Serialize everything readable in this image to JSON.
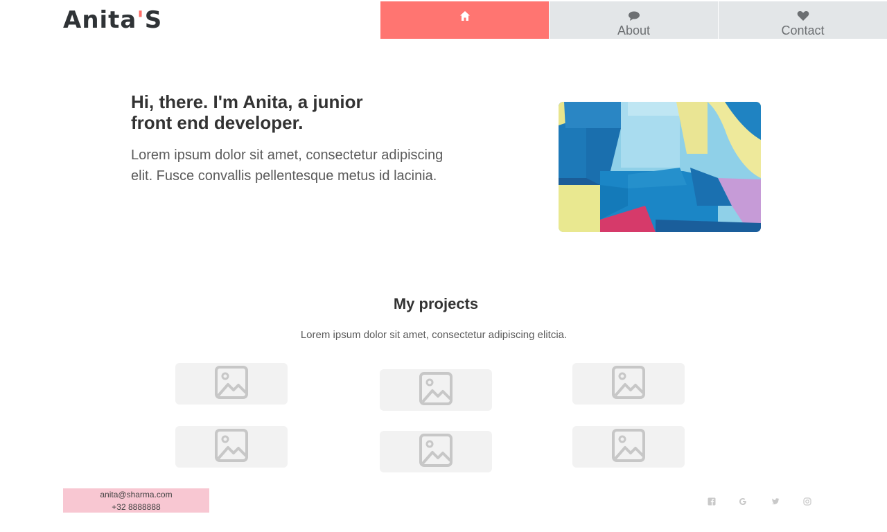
{
  "logo": {
    "name": "Anita",
    "apostrophe": "'",
    "suffix": "S"
  },
  "nav": {
    "items": [
      {
        "label": "",
        "icon": "home-icon",
        "active": true
      },
      {
        "label": "About",
        "icon": "comment-icon",
        "active": false
      },
      {
        "label": "Contact",
        "icon": "heart-icon",
        "active": false
      }
    ]
  },
  "hero": {
    "title": "Hi, there. I'm Anita, a junior front end developer.",
    "text": "Lorem ipsum dolor sit amet, consectetur adipiscing elit. Fusce convallis pellentesque metus id lacinia.",
    "image": "abstract-painting"
  },
  "projects": {
    "title": "My projects",
    "subtitle": "Lorem ipsum dolor sit amet, consectetur adipiscing elitcia.",
    "items": [
      {
        "icon": "image-placeholder-icon"
      },
      {
        "icon": "image-placeholder-icon"
      },
      {
        "icon": "image-placeholder-icon"
      },
      {
        "icon": "image-placeholder-icon"
      },
      {
        "icon": "image-placeholder-icon"
      },
      {
        "icon": "image-placeholder-icon"
      }
    ]
  },
  "footer": {
    "email": "anita@sharma.com",
    "phone": "+32 8888888",
    "social": [
      "facebook-icon",
      "google-icon",
      "twitter-icon",
      "instagram-icon"
    ]
  },
  "colors": {
    "accent": "#ff7571",
    "nav_bg": "#e3e6e8",
    "contact_bg": "#f8c7d2",
    "thumb_bg": "#f2f2f2"
  }
}
